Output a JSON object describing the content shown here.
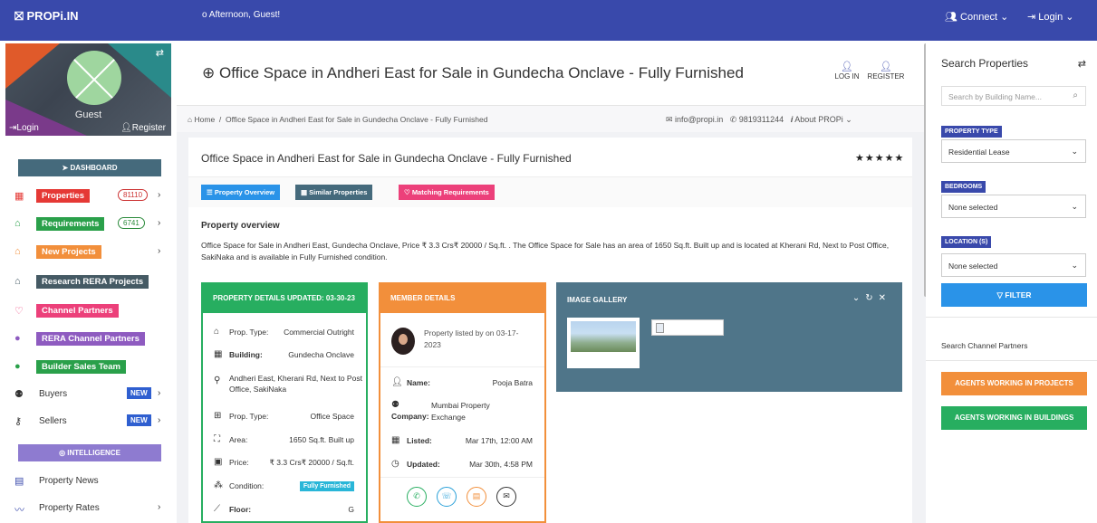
{
  "topbar": {
    "brand": "⛝ PROPi.IN",
    "greeting": "o  Afternoon, Guest!",
    "connect": "Connect",
    "login": "Login"
  },
  "profile": {
    "guest": "Guest",
    "login": "Login",
    "register": "Register"
  },
  "sidebar": {
    "dashboard": "DASHBOARD",
    "intelligence": "INTELLIGENCE",
    "items": [
      {
        "label": "Properties",
        "count": "81110",
        "color": "#e53935",
        "icon": "building-icon"
      },
      {
        "label": "Requirements",
        "count": "6741",
        "color": "#2aa04a",
        "icon": "home-icon"
      },
      {
        "label": "New Projects",
        "color": "#f28f3b",
        "icon": "house-outline-icon"
      },
      {
        "label": "Research RERA Projects",
        "color": "#455a64",
        "icon": "house-icon"
      },
      {
        "label": "Channel Partners",
        "color": "#ec407a",
        "icon": "handshake-icon"
      },
      {
        "label": "RERA Channel Partners",
        "color": "#8e5bc0",
        "icon": "user-icon"
      },
      {
        "label": "Builder Sales Team",
        "color": "#2aa04a",
        "icon": "user-tie-icon"
      },
      {
        "label": "Buyers",
        "badge": "NEW",
        "icon": "people-icon"
      },
      {
        "label": "Sellers",
        "badge": "NEW",
        "icon": "key-icon"
      }
    ],
    "bottom_items": [
      {
        "label": "Property News",
        "icon": "news-icon"
      },
      {
        "label": "Property Rates",
        "icon": "chart-line-icon"
      }
    ]
  },
  "header": {
    "title": "Office Space in Andheri East for Sale in Gundecha Onclave - Fully Furnished",
    "login": "LOG IN",
    "register": "REGISTER"
  },
  "breadcrumb": {
    "home": "Home",
    "current": "Office Space in Andheri East for Sale in Gundecha Onclave - Fully Furnished",
    "email": "info@propi.in",
    "phone": "9819311244",
    "about": "About PROPi"
  },
  "listing": {
    "title": "Office Space in Andheri East for Sale in Gundecha Onclave - Fully Furnished",
    "stars": "★★★★★",
    "tabs": {
      "overview": "Property Overview",
      "similar": "Similar Properties",
      "matching": "Matching Requirements"
    },
    "overview_heading": "Property overview",
    "overview_text": "Office Space for Sale in Andheri East, Gundecha Onclave, Price ₹ 3.3 Crs₹ 20000 / Sq.ft. . The Office Space for Sale has an area of 1650 Sq.ft. Built up and is located at Kherani Rd, Next to Post Office, SakiNaka and is available in Fully Furnished condition."
  },
  "property_details": {
    "header": "PROPERTY DETAILS   UPDATED: 03-30-23",
    "prop_type_label": "Prop. Type:",
    "prop_type_value": "Commercial Outright",
    "building_label": "Building:",
    "building_value": "Gundecha Onclave",
    "address": "Andheri East, Kherani Rd, Next to Post Office, SakiNaka",
    "prop_type2_label": "Prop. Type:",
    "prop_type2_value": "Office Space",
    "area_label": "Area:",
    "area_value": "1650 Sq.ft. Built up",
    "price_label": "Price:",
    "price_value": "₹ 3.3 Crs₹ 20000 / Sq.ft.",
    "condition_label": "Condition:",
    "condition_value": "Fully Furnished",
    "floor_label": "Floor:",
    "floor_value": "G"
  },
  "member_details": {
    "header": "MEMBER DETAILS",
    "listed_by": "Property listed by on 03-17-2023",
    "name_label": "Name:",
    "name_value": "Pooja Batra",
    "company_label": "Company:",
    "company_value": "Mumbai Property Exchange",
    "listed_label": "Listed:",
    "listed_value": "Mar 17th, 12:00 AM",
    "updated_label": "Updated:",
    "updated_value": "Mar 30th, 4:58 PM"
  },
  "gallery": {
    "header": "IMAGE GALLERY"
  },
  "search": {
    "title": "Search Properties",
    "placeholder": "Search by Building Name...",
    "property_type_label": "PROPERTY TYPE",
    "property_type_value": "Residential Lease",
    "bedrooms_label": "BEDROOMS",
    "bedrooms_value": "None selected",
    "location_label": "LOCATION (S)",
    "location_value": "None selected",
    "filter": "FILTER",
    "channel_partners": "Search Channel Partners",
    "agents_projects": "AGENTS WORKING IN PROJECTS",
    "agents_buildings": "AGENTS WORKING IN BUILDINGS"
  }
}
